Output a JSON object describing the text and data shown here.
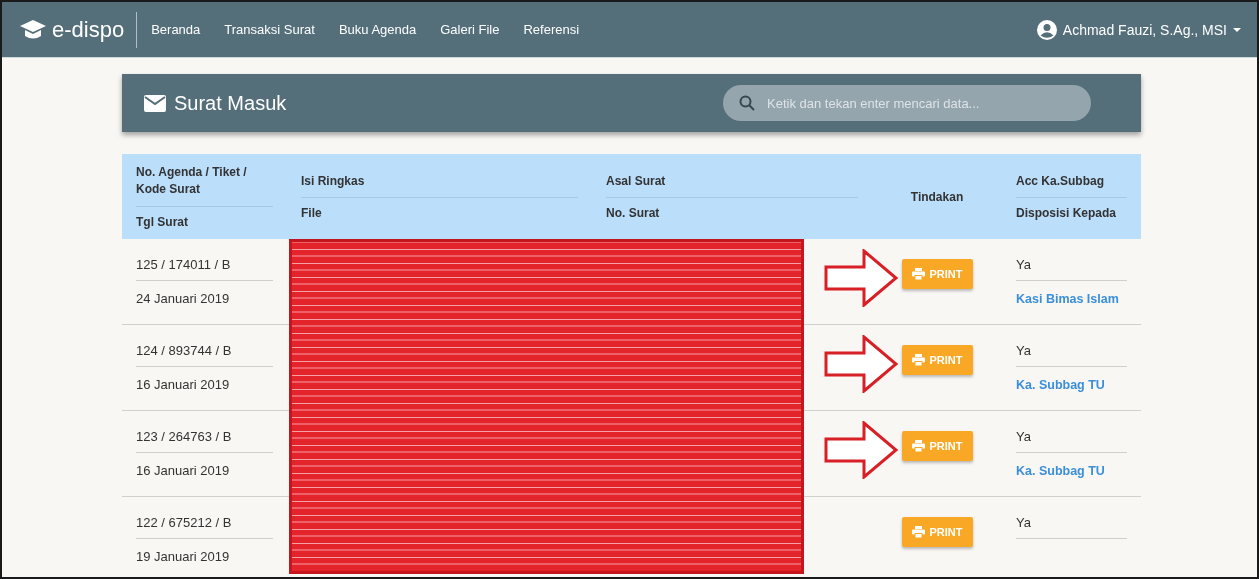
{
  "navbar": {
    "brand": "e-dispo",
    "items": [
      "Beranda",
      "Transaksi Surat",
      "Buku Agenda",
      "Galeri File",
      "Referensi"
    ],
    "user": "Achmad Fauzi, S.Ag., MSI"
  },
  "card": {
    "title": "Surat Masuk",
    "search": {
      "placeholder": "Ketik dan tekan enter mencari data..."
    }
  },
  "table": {
    "columns": [
      {
        "top": "No. Agenda / Tiket / Kode Surat",
        "bottom": "Tgl Surat"
      },
      {
        "top": "Isi Ringkas",
        "bottom": "File"
      },
      {
        "top": "Asal Surat",
        "bottom": "No. Surat"
      },
      {
        "single": "Tindakan"
      },
      {
        "top": "Acc Ka.Subbag",
        "bottom": "Disposisi Kepada"
      }
    ],
    "rows": [
      {
        "agenda": "125 / 174011 / B",
        "date": "24 Januari 2019",
        "action": "PRINT",
        "acc": "Ya",
        "disposisi": "Kasi Bimas Islam",
        "arrow": true
      },
      {
        "agenda": "124 / 893744 / B",
        "date": "16 Januari 2019",
        "action": "PRINT",
        "acc": "Ya",
        "disposisi": "Ka. Subbag TU",
        "arrow": true
      },
      {
        "agenda": "123 / 264763 / B",
        "date": "16 Januari 2019",
        "action": "PRINT",
        "acc": "Ya",
        "disposisi": "Ka. Subbag TU",
        "arrow": true
      },
      {
        "agenda": "122 / 675212 / B",
        "date": "19 Januari 2019",
        "action": "PRINT",
        "acc": "Ya",
        "arrow": false
      }
    ],
    "redacted": true
  }
}
